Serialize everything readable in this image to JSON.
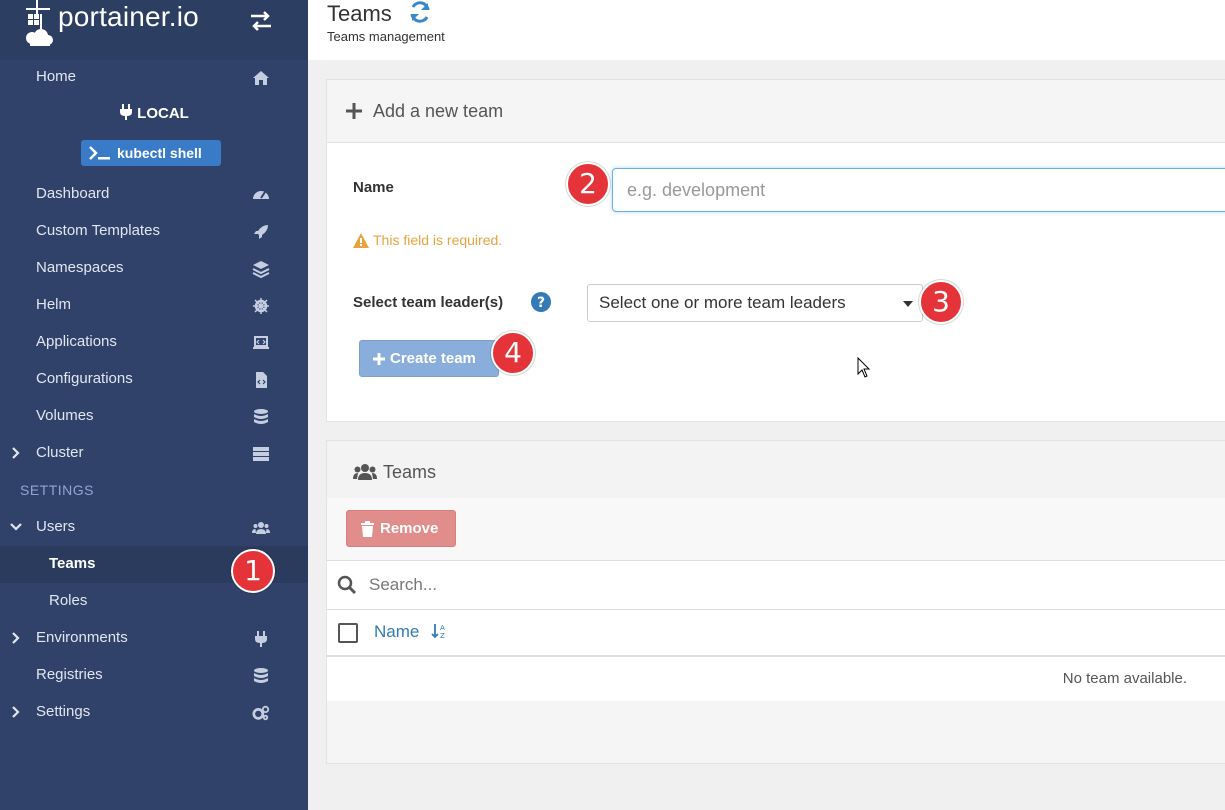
{
  "brand": {
    "name": "portainer.io"
  },
  "sidebar": {
    "home": "Home",
    "environment_name": "LOCAL",
    "kubectl_button": "kubectl shell",
    "items": [
      {
        "label": "Dashboard",
        "icon": "tachometer-icon"
      },
      {
        "label": "Custom Templates",
        "icon": "rocket-icon"
      },
      {
        "label": "Namespaces",
        "icon": "layers-icon"
      },
      {
        "label": "Helm",
        "icon": "helm-icon"
      },
      {
        "label": "Applications",
        "icon": "laptop-code-icon"
      },
      {
        "label": "Configurations",
        "icon": "file-code-icon"
      },
      {
        "label": "Volumes",
        "icon": "database-icon"
      },
      {
        "label": "Cluster",
        "icon": "server-icon"
      }
    ],
    "settings_title": "SETTINGS",
    "users": "Users",
    "teams": "Teams",
    "roles": "Roles",
    "environments": "Environments",
    "registries": "Registries",
    "settings": "Settings"
  },
  "header": {
    "title": "Teams",
    "subtitle": "Teams management"
  },
  "add_team": {
    "title": "Add a new team",
    "name_label": "Name",
    "name_placeholder": "e.g. development",
    "name_value": "",
    "warning": "This field is required.",
    "leaders_label": "Select team leader(s)",
    "leaders_placeholder": "Select one or more team leaders",
    "create_button": "Create team"
  },
  "teams_table": {
    "title": "Teams",
    "remove_button": "Remove",
    "search_placeholder": "Search...",
    "column_name": "Name",
    "empty_message": "No team available."
  },
  "markers": [
    "1",
    "2",
    "3",
    "4"
  ],
  "colors": {
    "sidebar_bg": "#30426a",
    "primary": "#337ab7",
    "danger": "#e08d8b",
    "warning": "#e8a33f",
    "marker": "#e5333a"
  }
}
